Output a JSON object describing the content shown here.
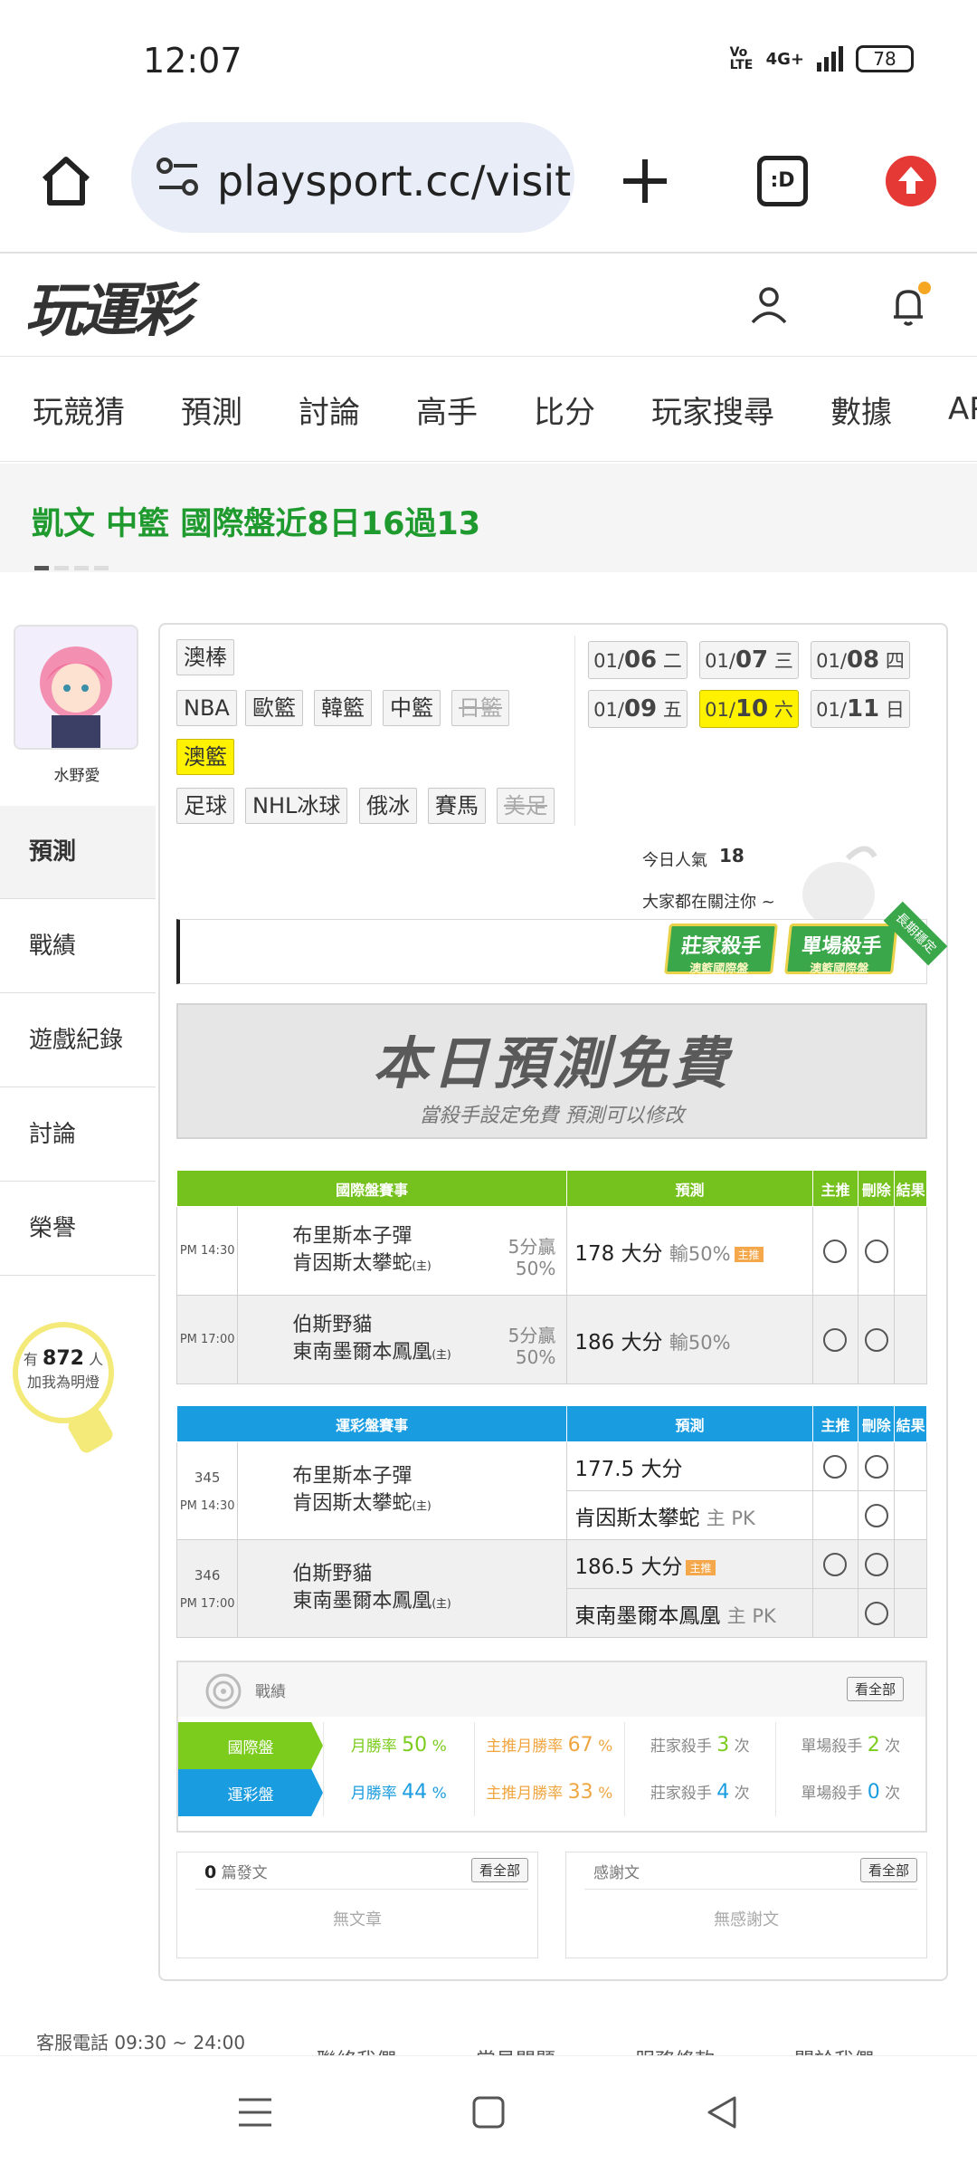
{
  "status": {
    "time": "12:07",
    "volte": "Vo LTE",
    "network": "4G+",
    "battery": "78"
  },
  "browser": {
    "url": "playsport.cc/visit"
  },
  "site": {
    "logo": "玩運彩"
  },
  "nav": {
    "items": [
      "玩競猜",
      "預測",
      "討論",
      "高手",
      "比分",
      "玩家搜尋",
      "數據",
      "APP"
    ]
  },
  "marquee": {
    "text": "凱文 中籃 國際盤近8日16過13"
  },
  "profile": {
    "name": "水野愛"
  },
  "sidebar": {
    "items": [
      "預測",
      "戰績",
      "遊戲紀錄",
      "討論",
      "榮譽"
    ],
    "fans_prefix": "有",
    "fans_count": "872",
    "fans_suffix": "人",
    "fans_cta": "加我為明燈"
  },
  "sports": {
    "row1": [
      "澳棒"
    ],
    "row2": [
      "NBA",
      "歐籃",
      "韓籃",
      "中籃",
      "日籃"
    ],
    "row3": [
      "澳籃"
    ],
    "row4": [
      "足球",
      "NHL冰球",
      "俄冰",
      "賽馬",
      "美足"
    ]
  },
  "dates": [
    {
      "md": "01/",
      "d": "06",
      "w": "二"
    },
    {
      "md": "01/",
      "d": "07",
      "w": "三"
    },
    {
      "md": "01/",
      "d": "08",
      "w": "四"
    },
    {
      "md": "01/",
      "d": "09",
      "w": "五"
    },
    {
      "md": "01/",
      "d": "10",
      "w": "六"
    },
    {
      "md": "01/",
      "d": "11",
      "w": "日"
    }
  ],
  "popularity": {
    "label": "今日人氣",
    "value": "18",
    "sub": "大家都在關注你 ~"
  },
  "badges": {
    "b1": "莊家殺手",
    "b1s": "澳籃國際盤",
    "b2": "單場殺手",
    "b2s": "澳籃國際盤",
    "b3": "長期穩定"
  },
  "banner": {
    "title": "本日預測免費",
    "sub": "當殺手設定免費 預測可以修改"
  },
  "intl_table": {
    "headers": [
      "國際盤賽事",
      "預測",
      "主推",
      "刪除",
      "結果"
    ],
    "rows": [
      {
        "time": "PM 14:30",
        "away": "布里斯本子彈",
        "home": "肯因斯太攀蛇",
        "host": "(主)",
        "odds1": "5分贏",
        "odds2": "50%",
        "pred": "178 大分",
        "res": "輸50%",
        "hot": "主推"
      },
      {
        "time": "PM 17:00",
        "away": "伯斯野貓",
        "home": "東南墨爾本鳳凰",
        "host": "(主)",
        "odds1": "5分贏",
        "odds2": "50%",
        "pred": "186 大分",
        "res": "輸50%"
      }
    ]
  },
  "lottery_table": {
    "headers": [
      "運彩盤賽事",
      "預測",
      "主推",
      "刪除",
      "結果"
    ],
    "rows": [
      {
        "no": "345",
        "time": "PM 14:30",
        "away": "布里斯本子彈",
        "home": "肯因斯太攀蛇",
        "host": "(主)",
        "pred1": "177.5 大分",
        "pred2": "肯因斯太攀蛇",
        "pred2s": "主 PK"
      },
      {
        "no": "346",
        "time": "PM 17:00",
        "away": "伯斯野貓",
        "home": "東南墨爾本鳳凰",
        "host": "(主)",
        "pred1": "186.5 大分",
        "hot": "主推",
        "pred2": "東南墨爾本鳳凰",
        "pred2s": "主 PK"
      }
    ]
  },
  "record": {
    "title": "戰績",
    "view_all": "看全部",
    "rows": [
      {
        "label": "國際盤",
        "color": "#7ccc1d",
        "c1l": "月勝率",
        "c1v": "50",
        "c1u": "%",
        "c2l": "主推月勝率",
        "c2v": "67",
        "c2u": "%",
        "c3l": "莊家殺手",
        "c3v": "3",
        "c3u": "次",
        "c4l": "單場殺手",
        "c4v": "2",
        "c4u": "次"
      },
      {
        "label": "運彩盤",
        "color": "#1a9ce0",
        "c1l": "月勝率",
        "c1v": "44",
        "c1u": "%",
        "c2l": "主推月勝率",
        "c2v": "33",
        "c2u": "%",
        "c3l": "莊家殺手",
        "c3v": "4",
        "c3u": "次",
        "c4l": "單場殺手",
        "c4v": "0",
        "c4u": "次"
      }
    ]
  },
  "posts": {
    "count": "0",
    "label": "篇發文",
    "view_all": "看全部",
    "empty": "無文章"
  },
  "thanks": {
    "label": "感謝文",
    "view_all": "看全部",
    "empty": "無感謝文"
  },
  "footer": {
    "phone": "客服電話 09:30 ~ 24:00",
    "links": [
      "聯絡我們",
      "常見問題",
      "服務條款",
      "關於我們"
    ]
  }
}
